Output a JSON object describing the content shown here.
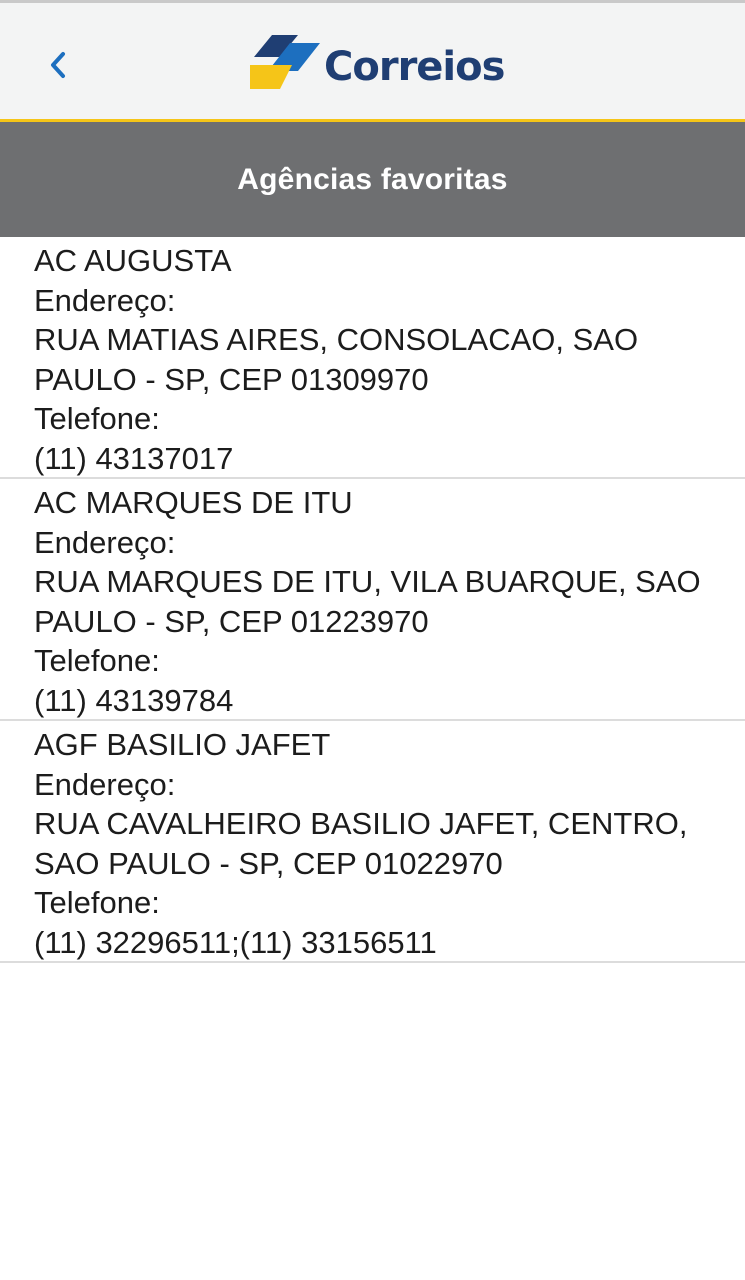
{
  "header": {
    "back_icon": "chevron-left-icon",
    "logo_text": "Correios",
    "logo_colors": {
      "yellow": "#f5c518",
      "blue": "#1f3e73",
      "accent_blue": "#1d6fbf"
    }
  },
  "title_bar": {
    "title": "Agências favoritas"
  },
  "agencies": [
    {
      "name": "AC AUGUSTA",
      "address_label": "Endereço:",
      "address_line1": "RUA MATIAS AIRES, CONSOLACAO, SAO",
      "address_line2": "PAULO - SP, CEP 01309970",
      "phone_label": "Telefone:",
      "phone": "(11) 43137017"
    },
    {
      "name": "AC MARQUES DE ITU",
      "address_label": "Endereço:",
      "address_line1": "RUA MARQUES DE ITU, VILA BUARQUE, SAO",
      "address_line2": "PAULO - SP, CEP 01223970",
      "phone_label": "Telefone:",
      "phone": "(11) 43139784"
    },
    {
      "name": "AGF BASILIO JAFET",
      "address_label": "Endereço:",
      "address_line1": "RUA CAVALHEIRO BASILIO JAFET, CENTRO,",
      "address_line2": "SAO PAULO - SP, CEP 01022970",
      "phone_label": "Telefone:",
      "phone": "(11) 32296511;(11) 33156511"
    }
  ]
}
